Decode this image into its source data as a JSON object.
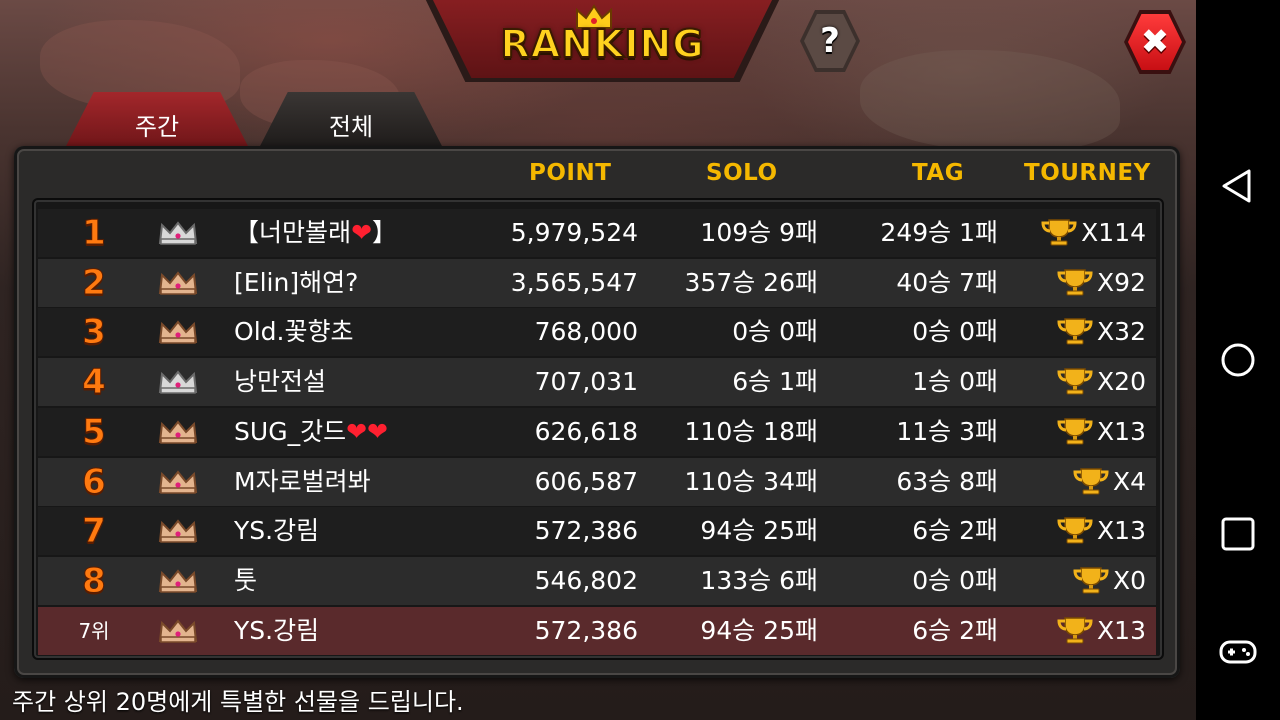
{
  "header": {
    "title": "RANKING",
    "help_label": "?",
    "close_label": "✖"
  },
  "tabs": [
    {
      "label": "주간",
      "active": true
    },
    {
      "label": "전체",
      "active": false
    }
  ],
  "columns": {
    "point": "POINT",
    "solo": "SOLO",
    "tag": "TAG",
    "tourney": "TOURNEY"
  },
  "rows": [
    {
      "rank": "1",
      "crown": "silver",
      "name": "【너만볼래❤】",
      "point": "5,979,524",
      "solo": "109승 9패",
      "tag": "249승 1패",
      "tourney": "X114"
    },
    {
      "rank": "2",
      "crown": "bronze",
      "name": "[Elin]해연?",
      "point": "3,565,547",
      "solo": "357승 26패",
      "tag": "40승 7패",
      "tourney": "X92"
    },
    {
      "rank": "3",
      "crown": "bronze",
      "name": "Old.꽃향초",
      "point": "768,000",
      "solo": "0승 0패",
      "tag": "0승 0패",
      "tourney": "X32"
    },
    {
      "rank": "4",
      "crown": "silver",
      "name": "낭만전설",
      "point": "707,031",
      "solo": "6승 1패",
      "tag": "1승 0패",
      "tourney": "X20"
    },
    {
      "rank": "5",
      "crown": "bronze",
      "name": "SUG_갓드❤❤",
      "point": "626,618",
      "solo": "110승 18패",
      "tag": "11승 3패",
      "tourney": "X13"
    },
    {
      "rank": "6",
      "crown": "bronze",
      "name": "M자로벌려봐",
      "point": "606,587",
      "solo": "110승 34패",
      "tag": "63승 8패",
      "tourney": "X4"
    },
    {
      "rank": "7",
      "crown": "bronze",
      "name": "YS.강림",
      "point": "572,386",
      "solo": "94승 25패",
      "tag": "6승 2패",
      "tourney": "X13"
    },
    {
      "rank": "8",
      "crown": "bronze",
      "name": "툿",
      "point": "546,802",
      "solo": "133승 6패",
      "tag": "0승 0패",
      "tourney": "X0"
    }
  ],
  "my_rank": {
    "rank": "7위",
    "crown": "bronze",
    "name": "YS.강림",
    "point": "572,386",
    "solo": "94승 25패",
    "tag": "6승 2패",
    "tourney": "X13"
  },
  "footer_text": "주간 상위 20명에게 특별한 선물을 드립니다.",
  "icons": {
    "crown": "crown-icon",
    "trophy": "trophy-icon",
    "help": "question-icon",
    "close": "close-icon",
    "nav_back": "back-triangle-icon",
    "nav_home": "home-circle-icon",
    "nav_recents": "recents-square-icon",
    "nav_game": "gamepad-icon"
  },
  "colors": {
    "header_gold": "#f5b800",
    "rank_orange": "#ff7a10",
    "tab_red": "#a3272b",
    "self_row": "#5a2a2c"
  }
}
